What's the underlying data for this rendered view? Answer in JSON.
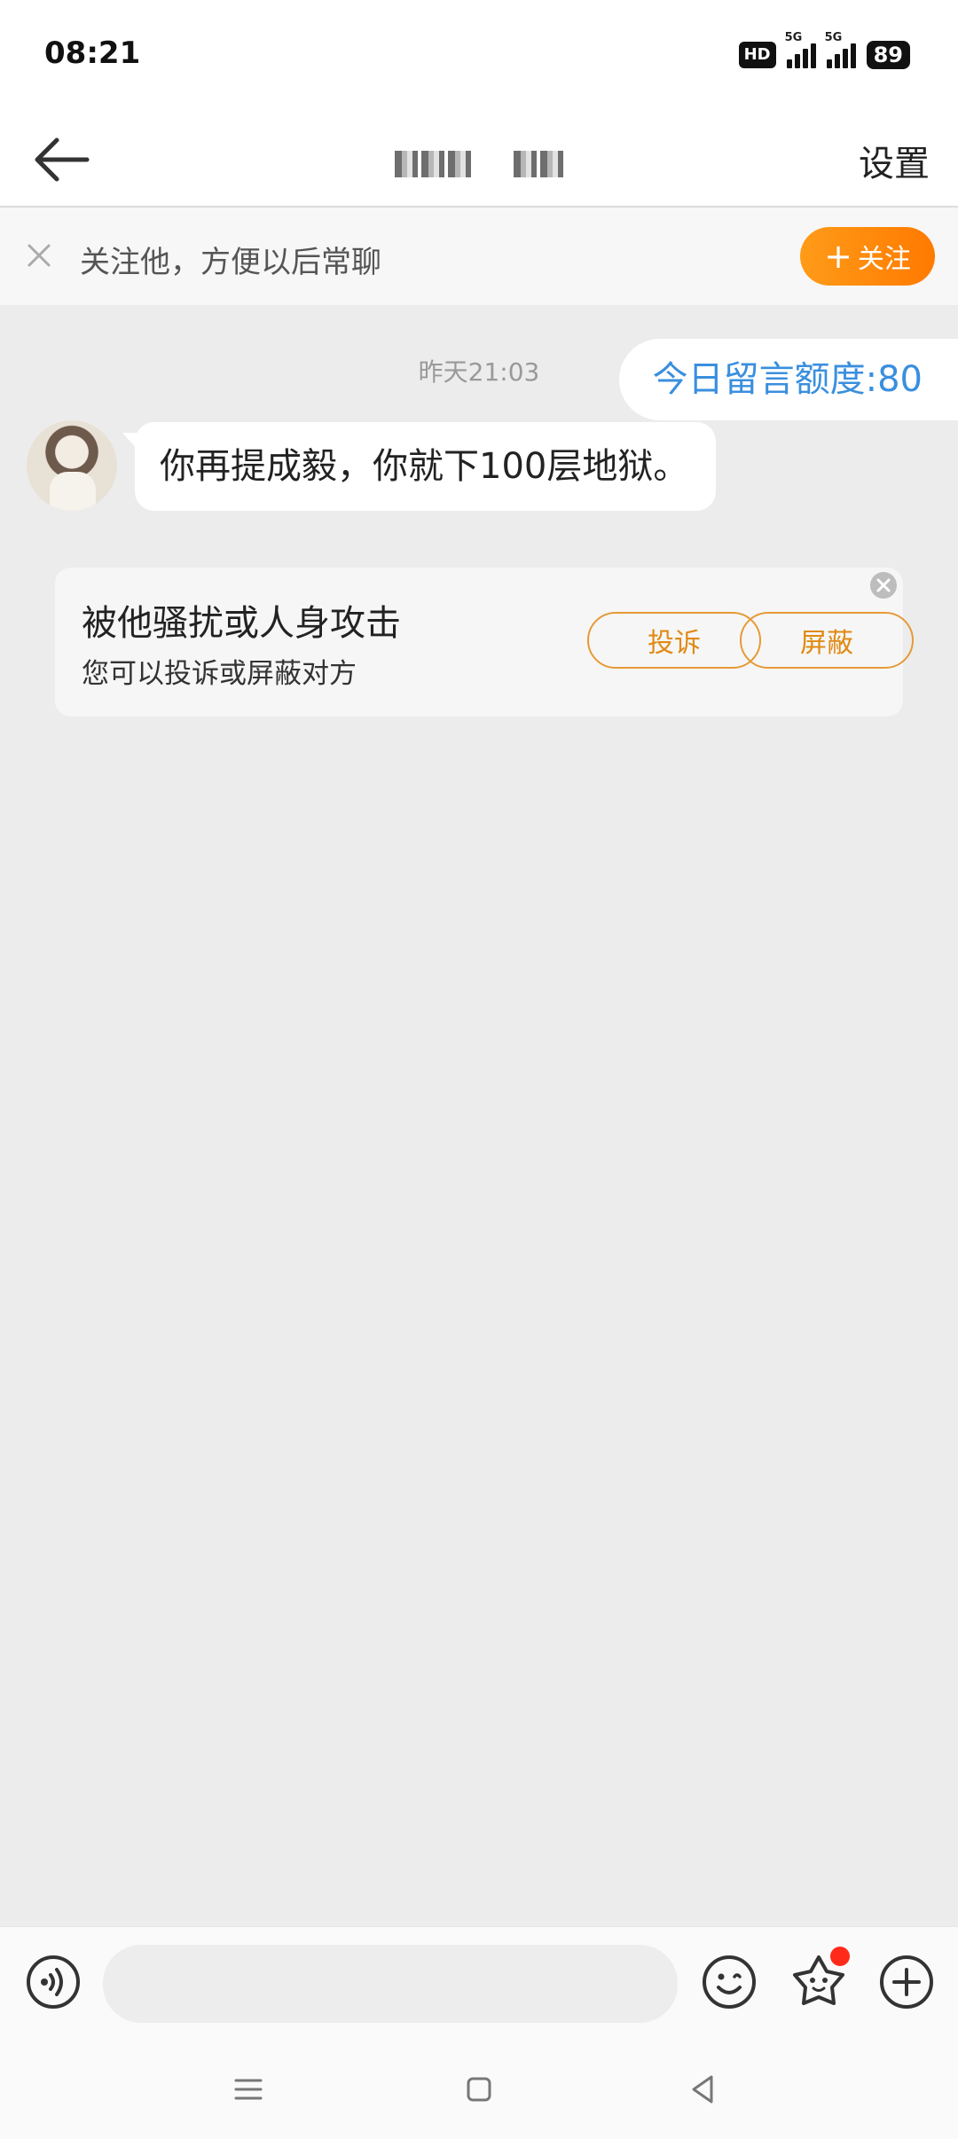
{
  "status_bar": {
    "time": "08:21",
    "network_badge": "HD",
    "signal_1_label": "5G",
    "signal_2_label": "5G",
    "battery": "89"
  },
  "header": {
    "title_obscured": "",
    "settings_label": "设置"
  },
  "follow_banner": {
    "text": "关注他，方便以后常聊",
    "button_label": "关注",
    "button_icon": "plus-icon"
  },
  "chat": {
    "timestamp": "昨天21:03",
    "quota_text": "今日留言额度:80",
    "messages": [
      {
        "from": "other",
        "text": "你再提成毅，你就下100层地狱。"
      }
    ]
  },
  "harassment_card": {
    "title": "被他骚扰或人身攻击",
    "subtitle": "您可以投诉或屏蔽对方",
    "report_label": "投诉",
    "block_label": "屏蔽"
  },
  "input_bar": {
    "placeholder": "",
    "icons": [
      "voice-icon",
      "emoji-icon",
      "sticker-icon",
      "plus-icon"
    ]
  },
  "colors": {
    "accent_orange": "#ff8a00",
    "quota_blue": "#3a8fde",
    "badge_red": "#ff2a1a"
  }
}
